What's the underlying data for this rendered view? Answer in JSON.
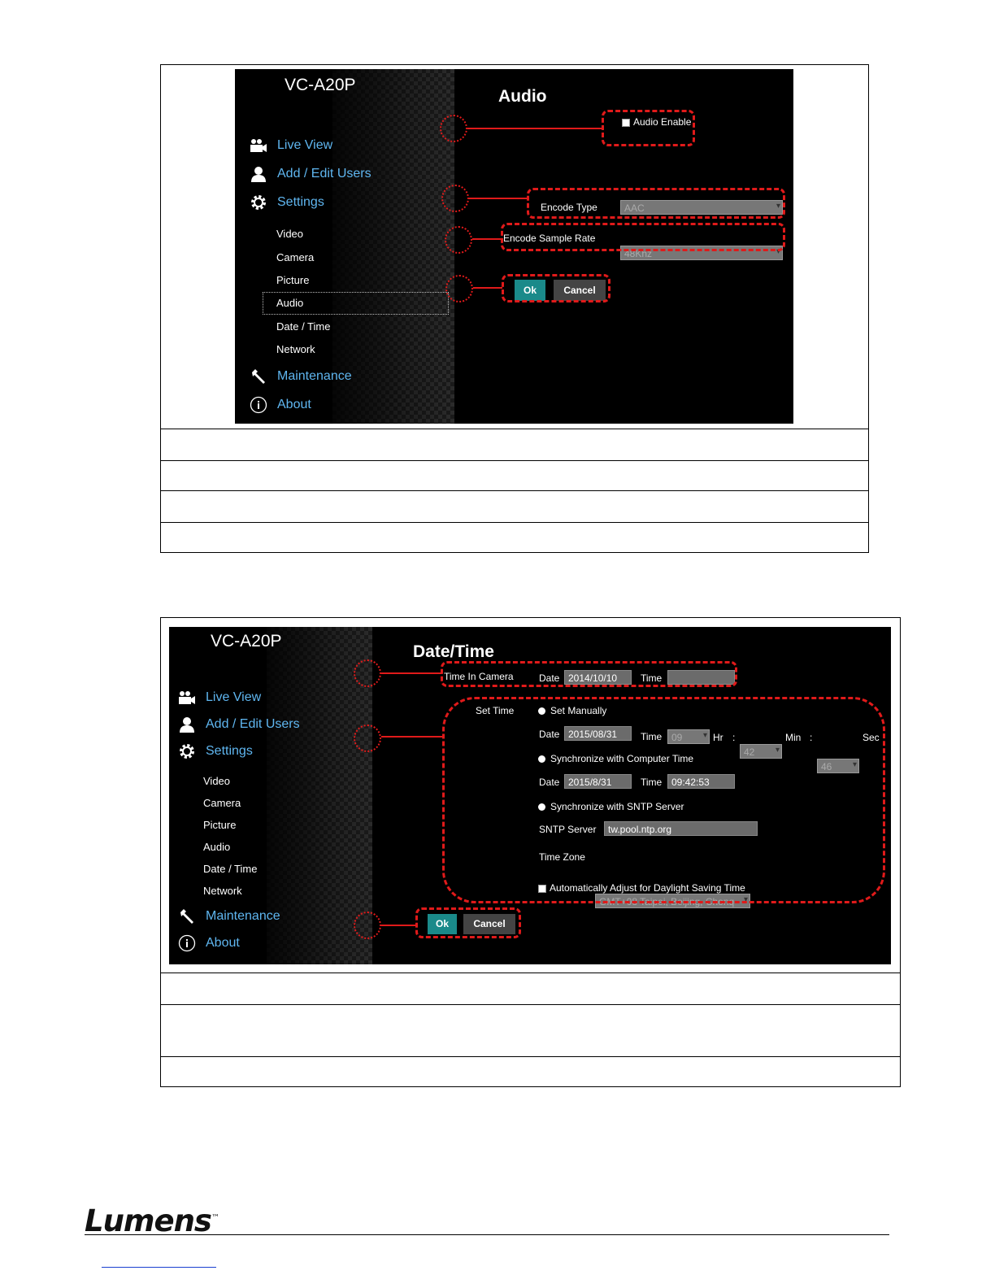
{
  "audio_screen": {
    "model": "VC-A20P",
    "title": "Audio",
    "nav": {
      "live_view": "Live View",
      "add_edit_users": "Add / Edit Users",
      "settings": "Settings",
      "maintenance": "Maintenance",
      "about": "About"
    },
    "sub": {
      "video": "Video",
      "camera": "Camera",
      "picture": "Picture",
      "audio": "Audio",
      "date_time": "Date / Time",
      "network": "Network"
    },
    "audio_enable": "Audio Enable",
    "encode_type_label": "Encode Type",
    "encode_type_value": "AAC",
    "sample_rate_label": "Encode Sample Rate",
    "sample_rate_value": "48Khz",
    "ok": "Ok",
    "cancel": "Cancel"
  },
  "datetime_screen": {
    "model": "VC-A20P",
    "title": "Date/Time",
    "nav": {
      "live_view": "Live View",
      "add_edit_users": "Add / Edit Users",
      "settings": "Settings",
      "maintenance": "Maintenance",
      "about": "About"
    },
    "sub": {
      "video": "Video",
      "camera": "Camera",
      "picture": "Picture",
      "audio": "Audio",
      "date_time": "Date / Time",
      "network": "Network"
    },
    "time_in_camera": "Time In Camera",
    "date_label": "Date",
    "time_label": "Time",
    "camera_date": "2014/10/10",
    "camera_time": "",
    "set_time": "Set Time",
    "set_manually": "Set Manually",
    "manual_date": "2015/08/31",
    "manual_hr": "09",
    "hr": "Hr",
    "colon": ":",
    "manual_min": "42",
    "min": "Min",
    "manual_sec": "46",
    "sec": "Sec",
    "sync_computer": "Synchronize with Computer Time",
    "pc_date": "2015/8/31",
    "pc_time": "09:42:53",
    "sync_sntp": "Synchronize with SNTP Server",
    "sntp_label": "SNTP Server",
    "sntp_value": "tw.pool.ntp.org",
    "tz_label": "Time Zone",
    "tz_value": "GMT+08 Taipei, Beijing, Chonq",
    "dst": "Automatically Adjust for Daylight Saving Time",
    "ok": "Ok",
    "cancel": "Cancel"
  },
  "footer": {
    "brand": "Lumens",
    "tm": "™"
  }
}
